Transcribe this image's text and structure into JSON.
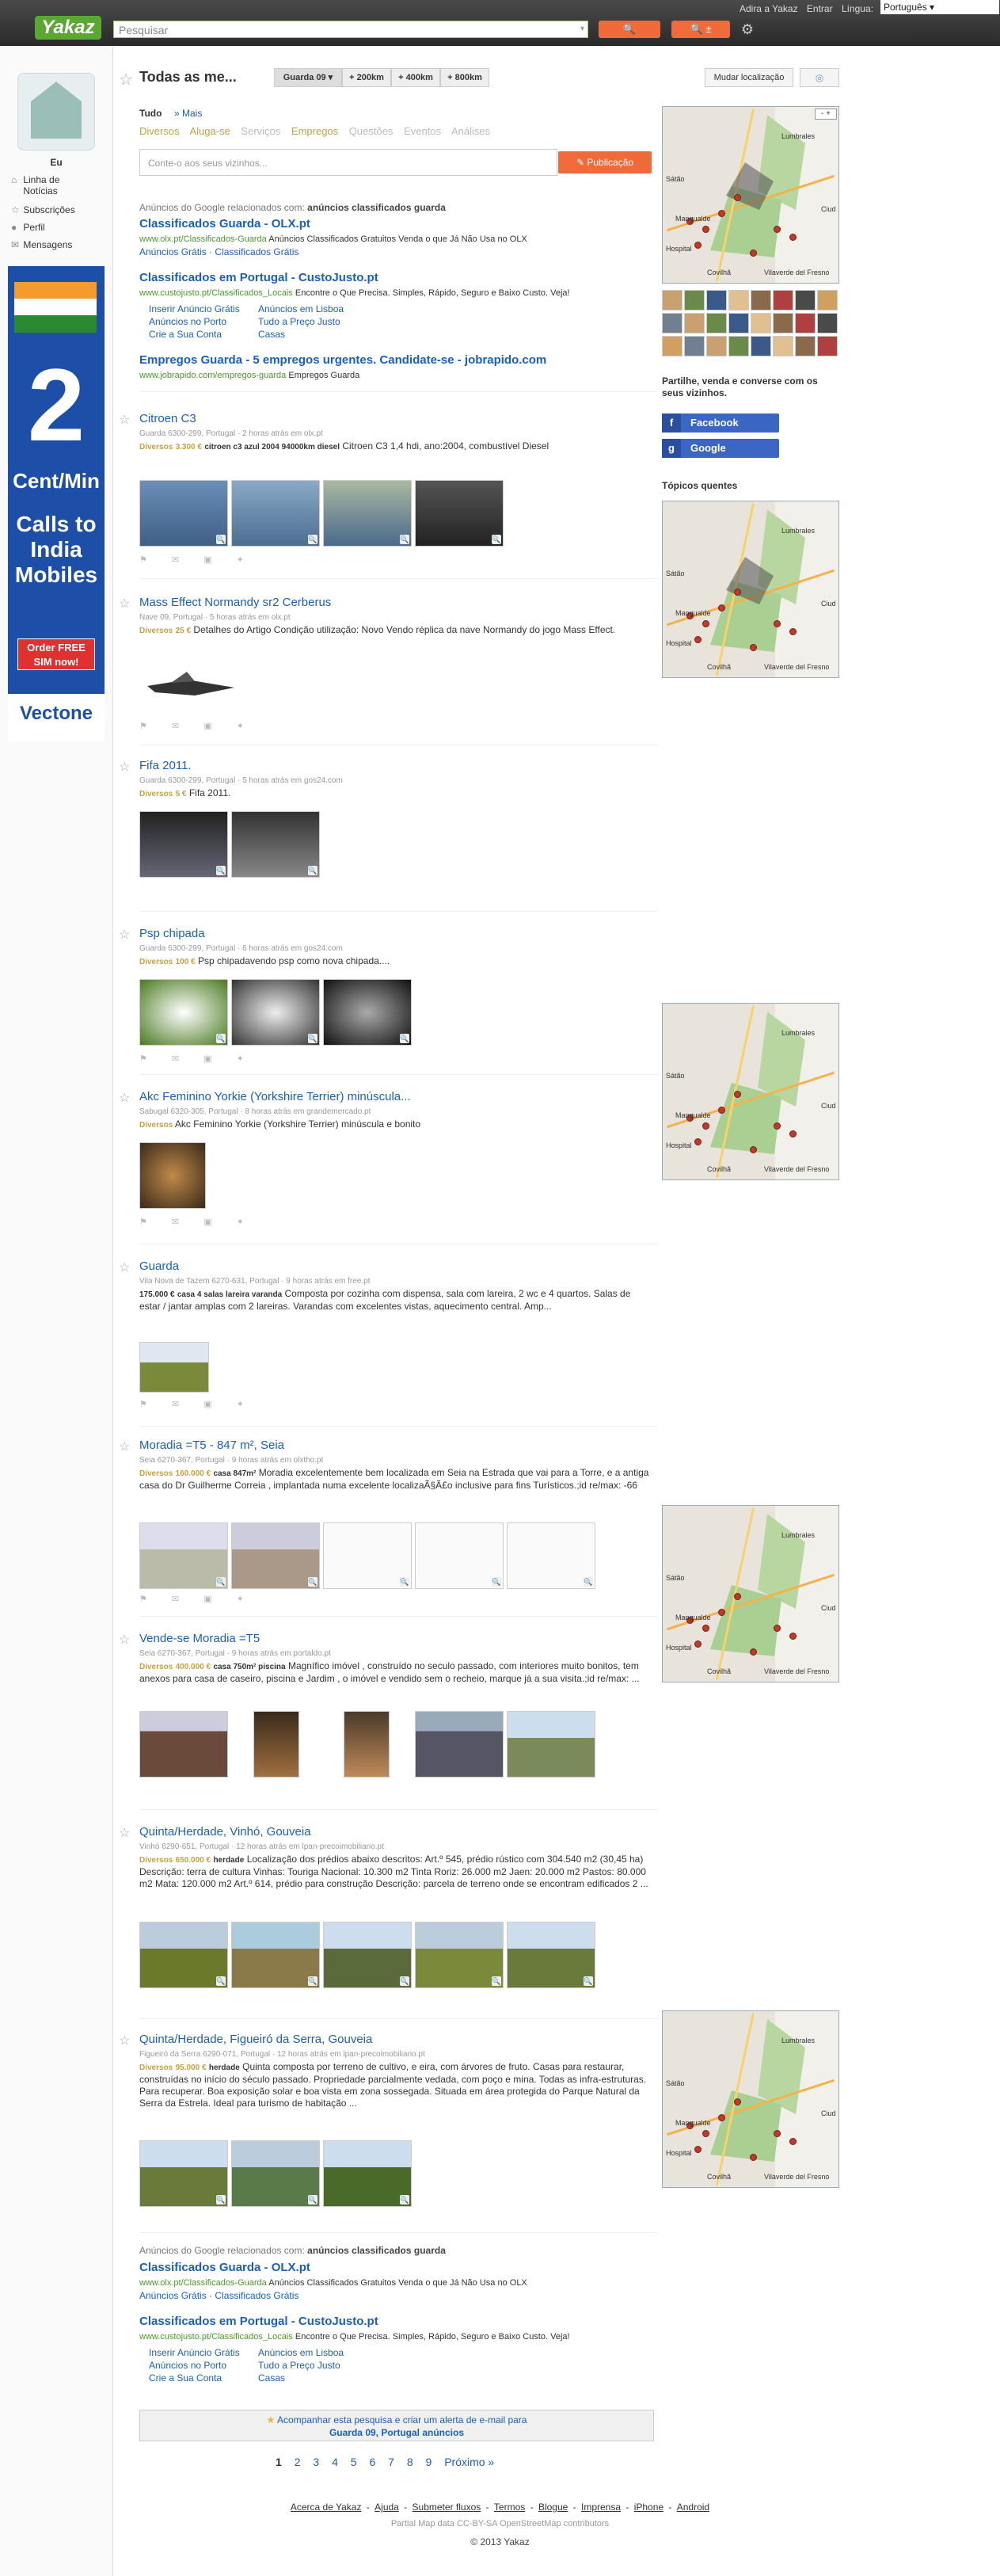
{
  "header": {
    "logo": "Yakaz",
    "search_placeholder": "Pesquisar",
    "search_button": "🔍",
    "alert_button": "🔍 ±",
    "links": [
      "Adira a Yakaz",
      "Entrar",
      "Língua:"
    ],
    "language": "Português ▾"
  },
  "sidebar": {
    "user": "Eu",
    "items": [
      {
        "icon": "home-icon",
        "label": "Linha de Notícias"
      },
      {
        "icon": "star-icon",
        "label": "Subscrições"
      },
      {
        "icon": "person-icon",
        "label": "Perfil"
      },
      {
        "icon": "message-icon",
        "label": "Mensagens"
      }
    ],
    "ad": {
      "number": "2",
      "cent": "Cent/Min",
      "calls": "Calls to India Mobiles",
      "order": "Order FREE SIM now!",
      "brand": "Vectone"
    }
  },
  "main": {
    "title": "Todas as me...",
    "location_select": "Guarda 09 ▾",
    "ranges": [
      "+ 200km",
      "+ 400km",
      "+ 800km"
    ],
    "change_location": "Mudar localização",
    "filter_all": "Tudo",
    "filter_more": "» Mais",
    "categories": [
      "Diversos",
      "Aluga-se",
      "Serviços",
      "Empregos",
      "Questões",
      "Eventos",
      "Análises"
    ],
    "post_placeholder": "Conte-o aos seus vizinhos...",
    "post_button": "✎ Publicação"
  },
  "google_ads_top": {
    "heading": "Anúncios do Google relacionados com:",
    "heading_bold": "anúncios classificados guarda",
    "ads": [
      {
        "title": "Classificados Guarda - OLX.pt",
        "url": "www.olx.pt/Classificados-Guarda",
        "text": "Anúncios Classificados Gratuitos Venda o que Já Não Usa no OLX",
        "sublinks": [
          "Anúncios Grátis",
          "Classificados Grátis"
        ]
      },
      {
        "title": "Classificados em Portugal - CustoJusto.pt",
        "url": "www.custojusto.pt/Classificados_Locais",
        "text": "Encontre o Que Precisa. Simples, Rápido, Seguro e Baixo Custo. Veja!",
        "sublinks": [
          "Inserir Anúncio Grátis",
          "Anúncios em Lisboa",
          "Anúncios no Porto",
          "Tudo a Preço Justo",
          "Crie a Sua Conta",
          "Casas"
        ]
      },
      {
        "title": "Empregos Guarda - 5 empregos urgentes. Candidate-se - jobrapido.com",
        "url": "www.jobrapido.com/empregos-guarda",
        "text": "Empregos Guarda",
        "sublinks": []
      }
    ]
  },
  "listings": [
    {
      "title": "Citroen C3",
      "meta": "Guarda 6300-299, Portugal  ·  2 horas atrás em olx.pt",
      "cat": "Diversos",
      "price": "3.300 €",
      "kw": "citroen c3 azul 2004 94000km diesel",
      "desc": "Citroen C3 1,4 hdi, ano:2004, combustível Diesel"
    },
    {
      "title": "Mass Effect Normandy sr2 Cerberus",
      "meta": "Nave 09, Portugal  ·  5 horas atrás em olx.pt",
      "cat": "Diversos",
      "price": "25 €",
      "kw": "",
      "desc": "Detalhes do Artigo Condição utilização: Novo Vendo réplica da nave Normandy do jogo Mass Effect."
    },
    {
      "title": "Fifa 2011.",
      "meta": "Guarda 6300-299, Portugal  ·  5 horas atrás em gos24.com",
      "cat": "Diversos",
      "price": "5 €",
      "kw": "",
      "desc": "Fifa 2011."
    },
    {
      "title": "Psp chipada",
      "meta": "Guarda 6300-299, Portugal  ·  6 horas atrás em gos24.com",
      "cat": "Diversos",
      "price": "100 €",
      "kw": "",
      "desc": "Psp chipadavendo psp como nova chipada...."
    },
    {
      "title": "Akc Feminino Yorkie (Yorkshire Terrier) minúscula...",
      "meta": "Sabugal 6320-305, Portugal  ·  8 horas atrás em grandemercado.pt",
      "cat": "Diversos",
      "price": "",
      "kw": "",
      "desc": "Akc Feminino Yorkie (Yorkshire Terrier) minúscula e bonito"
    },
    {
      "title": "Guarda",
      "meta": "Vila Nova de Tazem 6270-631, Portugal  ·  9 horas atrás em free.pt",
      "cat": "",
      "price": "175.000 €",
      "kw": "casa 4 salas lareira varanda",
      "desc": "Composta por cozinha com dispensa, sala com lareira, 2 wc e 4 quartos. Salas de estar / jantar amplas com 2 lareiras. Varandas com excelentes vistas, aquecimento central. Amp..."
    },
    {
      "title": "Moradia =T5 - 847 m², Seia",
      "meta": "Seia 6270-367, Portugal  ·  9 horas atrás em olxtho.pt",
      "cat": "Diversos",
      "price": "160.000 €",
      "kw": "casa 847m²",
      "desc": "Moradia excelentemente bem localizada em Seia na Estrada que vai para a Torre, e a antiga casa do Dr Guilherme Correia , implantada numa excelente localizaÃ§Ã£o inclusive para fins Turísticos.;id re/max: -66"
    },
    {
      "title": "Vende-se Moradia =T5",
      "meta": "Seia 6270-367, Portugal  ·  9 horas atrás em portaldo.pt",
      "cat": "Diversos",
      "price": "400.000 €",
      "kw": "casa 750m² piscina",
      "desc": "Magnífico imóvel , construído no seculo passado, com interiores muito bonitos, tem anexos para casa de caseiro, piscina e Jardim , o imóvel e vendido sem o recheio, marque já a sua visita.;id re/max: ..."
    },
    {
      "title": "Quinta/Herdade, Vinhó, Gouveia",
      "meta": "Vinhó 6290-651, Portugal  ·  12 horas atrás em lpan-precoimobiliario.pt",
      "cat": "Diversos",
      "price": "650.000 €",
      "kw": "herdade",
      "desc": "Localização dos prédios abaixo descritos: Art.º 545, prédio rústico com 304.540 m2 (30,45 ha) Descrição: terra de cultura Vinhas: Touriga Nacional: 10.300 m2 Tinta Roriz: 26.000 m2 Jaen: 20.000 m2 Pastos: 80.000 m2 Mata: 120.000 m2 Art.º 614, prédio para construção Descrição: parcela de terreno onde se encontram edificados 2 ..."
    },
    {
      "title": "Quinta/Herdade, Figueiró da Serra, Gouveia",
      "meta": "Figueiró da Serra 6290-071, Portugal  ·  12 horas atrás em lpan-precoimobiliario.pt",
      "cat": "Diversos",
      "price": "95.000 €",
      "kw": "herdade",
      "desc": "Quinta composta por terreno de cultivo, e eira, com árvores de fruto. Casas para restaurar, construídas no início do século passado. Propriedade parcialmente vedada, com poço e mina. Todas as infra-estruturas. Para recuperar. Boa exposição solar e boa vista em zona sossegada. Situada em área protegida do Parque Natural da Serra da Estrela. Ideal para turismo de habitação ..."
    }
  ],
  "google_ads_bottom": {
    "heading": "Anúncios do Google relacionados com:",
    "heading_bold": "anúncios classificados guarda",
    "ads": [
      {
        "title": "Classificados Guarda - OLX.pt",
        "url": "www.olx.pt/Classificados-Guarda",
        "text": "Anúncios Classificados Gratuitos Venda o que Já Não Usa no OLX",
        "sublinks": [
          "Anúncios Grátis",
          "Classificados Grátis"
        ]
      },
      {
        "title": "Classificados em Portugal - CustoJusto.pt",
        "url": "www.custojusto.pt/Classificados_Locais",
        "text": "Encontre o Que Precisa. Simples, Rápido, Seguro e Baixo Custo. Veja!",
        "sublinks": [
          "Inserir Anúncio Grátis",
          "Anúncios em Lisboa",
          "Anúncios no Porto",
          "Tudo a Preço Justo",
          "Crie a Sua Conta",
          "Casas"
        ]
      }
    ]
  },
  "right": {
    "share_text": "Partilhe, venda e converse com os seus vizinhos.",
    "facebook": "Facebook",
    "google": "Google",
    "topics": "Tópicos quentes",
    "map_labels": [
      "Lumbrales",
      "Sátão",
      "Mangualde",
      "Hospital",
      "Covilhã",
      "Vilaverde del Fresno",
      "Ciud"
    ]
  },
  "bottom": {
    "alert_line1": "Acompanhar esta pesquisa e criar um alerta de e-mail para",
    "alert_line2": "Guarda 09, Portugal anúncios",
    "pages": [
      "1",
      "2",
      "3",
      "4",
      "5",
      "6",
      "7",
      "8",
      "9",
      "Próximo »"
    ],
    "footer_links": [
      "Acerca de Yakaz",
      "Ajuda",
      "Submeter fluxos",
      "Termos",
      "Blogue",
      "Imprensa",
      "iPhone",
      "Android"
    ],
    "map_credit": "Partial Map data CC-BY-SA OpenStreetMap contributors",
    "copyright": "© 2013 Yakaz"
  }
}
